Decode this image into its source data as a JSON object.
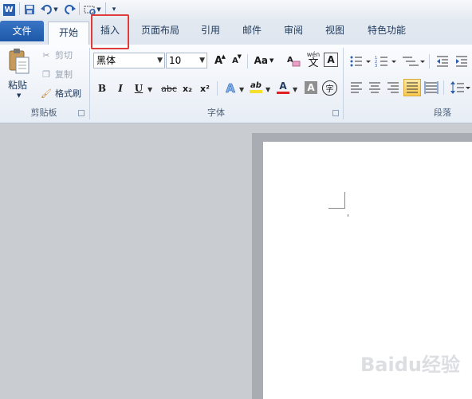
{
  "app": {
    "logo_letter": "W"
  },
  "tabs": [
    "文件",
    "开始",
    "插入",
    "页面布局",
    "引用",
    "邮件",
    "审阅",
    "视图",
    "特色功能"
  ],
  "clipboard": {
    "paste": "粘贴",
    "cut": "剪切",
    "copy": "复制",
    "format_painter": "格式刷",
    "group_label": "剪贴板"
  },
  "font": {
    "name": "黑体",
    "size": "10",
    "group_label": "字体",
    "bold": "B",
    "italic": "I",
    "underline": "U",
    "strike": "abc",
    "subscript": "x₂",
    "superscript": "x²",
    "case": "Aa",
    "grow": "A",
    "shrink": "A",
    "phonetic": "wén",
    "phonetic_char": "文",
    "clear": "A",
    "effects": "A",
    "highlight": "ab",
    "font_color": "A",
    "char_shading": "A",
    "enclose": "字"
  },
  "paragraph": {
    "group_label": "段落"
  },
  "colors": {
    "file_tab": "#1c57a8",
    "highlight_box": "#e03b3b",
    "font_color_bar": "#e02020",
    "highlight_bar": "#f5e12b",
    "accent": "#1e395b"
  },
  "watermark": {
    "text": "Baidu经验"
  }
}
